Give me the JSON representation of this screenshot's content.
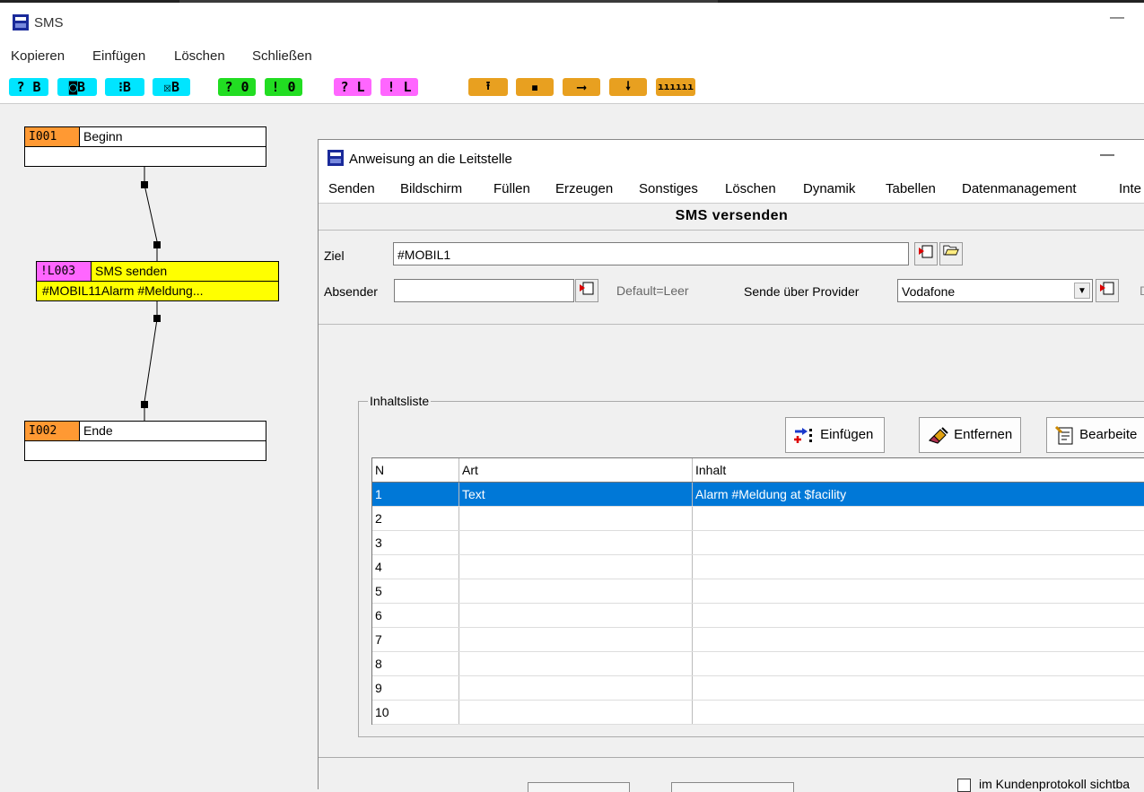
{
  "main": {
    "title": "SMS",
    "menu": [
      "Kopieren",
      "Einfügen",
      "Löschen",
      "Schließen"
    ],
    "toolbar": {
      "cyan": [
        "? B",
        "◙B",
        "⁝B",
        "☒B"
      ],
      "green": [
        "? 0",
        "! 0"
      ],
      "magenta": [
        "? L",
        "! L"
      ],
      "orange": [
        "⭱",
        "▪",
        "⟶",
        "🠗",
        "ıııııı"
      ]
    }
  },
  "flow": {
    "nodes": [
      {
        "id": "I001",
        "label": "Beginn",
        "sub": ""
      },
      {
        "id": "!L003",
        "label": "SMS senden",
        "sub": "#MOBIL11Alarm #Meldung..."
      },
      {
        "id": "I002",
        "label": "Ende",
        "sub": ""
      }
    ]
  },
  "dialog": {
    "title": "Anweisung an die Leitstelle",
    "menu": [
      "Senden",
      "Bildschirm",
      "Füllen",
      "Erzeugen",
      "Sonstiges",
      "Löschen",
      "Dynamik",
      "Tabellen",
      "Datenmanagement",
      "Inte"
    ],
    "heading": "SMS versenden",
    "ziel_label": "Ziel",
    "ziel_value": "#MOBIL1",
    "absender_label": "Absender",
    "absender_value": "",
    "default_hint": "Default=Leer",
    "provider_label": "Sende über Provider",
    "provider_value": "Vodafone",
    "trail_char": "D",
    "group_label": "Inhaltsliste",
    "btn_insert": "Einfügen",
    "btn_remove": "Entfernen",
    "btn_edit": "Bearbeite",
    "columns": [
      "N",
      "Art",
      "Inhalt"
    ],
    "rows": [
      {
        "n": "1",
        "art": "Text",
        "inhalt": "Alarm #Meldung at $facility"
      },
      {
        "n": "2",
        "art": "",
        "inhalt": ""
      },
      {
        "n": "3",
        "art": "",
        "inhalt": ""
      },
      {
        "n": "4",
        "art": "",
        "inhalt": ""
      },
      {
        "n": "5",
        "art": "",
        "inhalt": ""
      },
      {
        "n": "6",
        "art": "",
        "inhalt": ""
      },
      {
        "n": "7",
        "art": "",
        "inhalt": ""
      },
      {
        "n": "8",
        "art": "",
        "inhalt": ""
      },
      {
        "n": "9",
        "art": "",
        "inhalt": ""
      },
      {
        "n": "10",
        "art": "",
        "inhalt": ""
      }
    ],
    "checkbox_label": "im Kundenprotokoll sichtba"
  },
  "colors": {
    "selected_row": "#0078d7",
    "node_id_orange": "#ff9933",
    "node_yellow": "#ffff00",
    "node_id_magenta": "#ff66ff"
  }
}
